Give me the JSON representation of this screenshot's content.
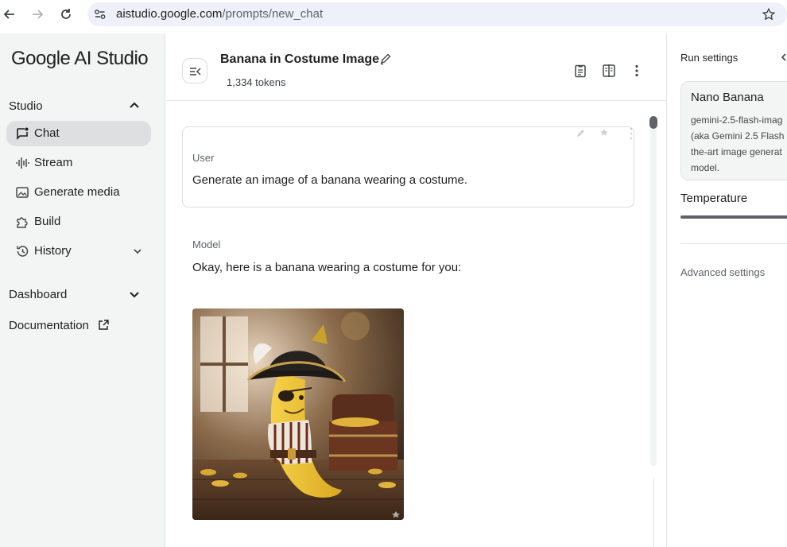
{
  "browser": {
    "url_host": "aistudio.google.com",
    "url_path": "/prompts/new_chat"
  },
  "nav": {
    "logo": "Google AI Studio",
    "studio_section": "Studio",
    "items": [
      {
        "label": "Chat",
        "icon": "chat-icon",
        "active": true
      },
      {
        "label": "Stream",
        "icon": "stream-icon"
      },
      {
        "label": "Generate media",
        "icon": "image-icon"
      },
      {
        "label": "Build",
        "icon": "puzzle-icon"
      },
      {
        "label": "History",
        "icon": "history-icon"
      }
    ],
    "dashboard": "Dashboard",
    "documentation": "Documentation"
  },
  "header": {
    "title": "Banana in Costume Image",
    "tokens": "1,334 tokens"
  },
  "chat": {
    "user_role": "User",
    "user_message": "Generate an image of a banana wearing a costume.",
    "model_role": "Model",
    "model_message": "Okay, here is a banana wearing a costume for you:"
  },
  "run_settings": {
    "title": "Run settings",
    "model_name": "Nano Banana",
    "model_desc_1": "gemini-2.5-flash-imag",
    "model_desc_2": "(aka Gemini 2.5 Flash",
    "model_desc_3": "the-art image generat",
    "model_desc_4": "model.",
    "temperature": "Temperature",
    "advanced": "Advanced settings"
  }
}
